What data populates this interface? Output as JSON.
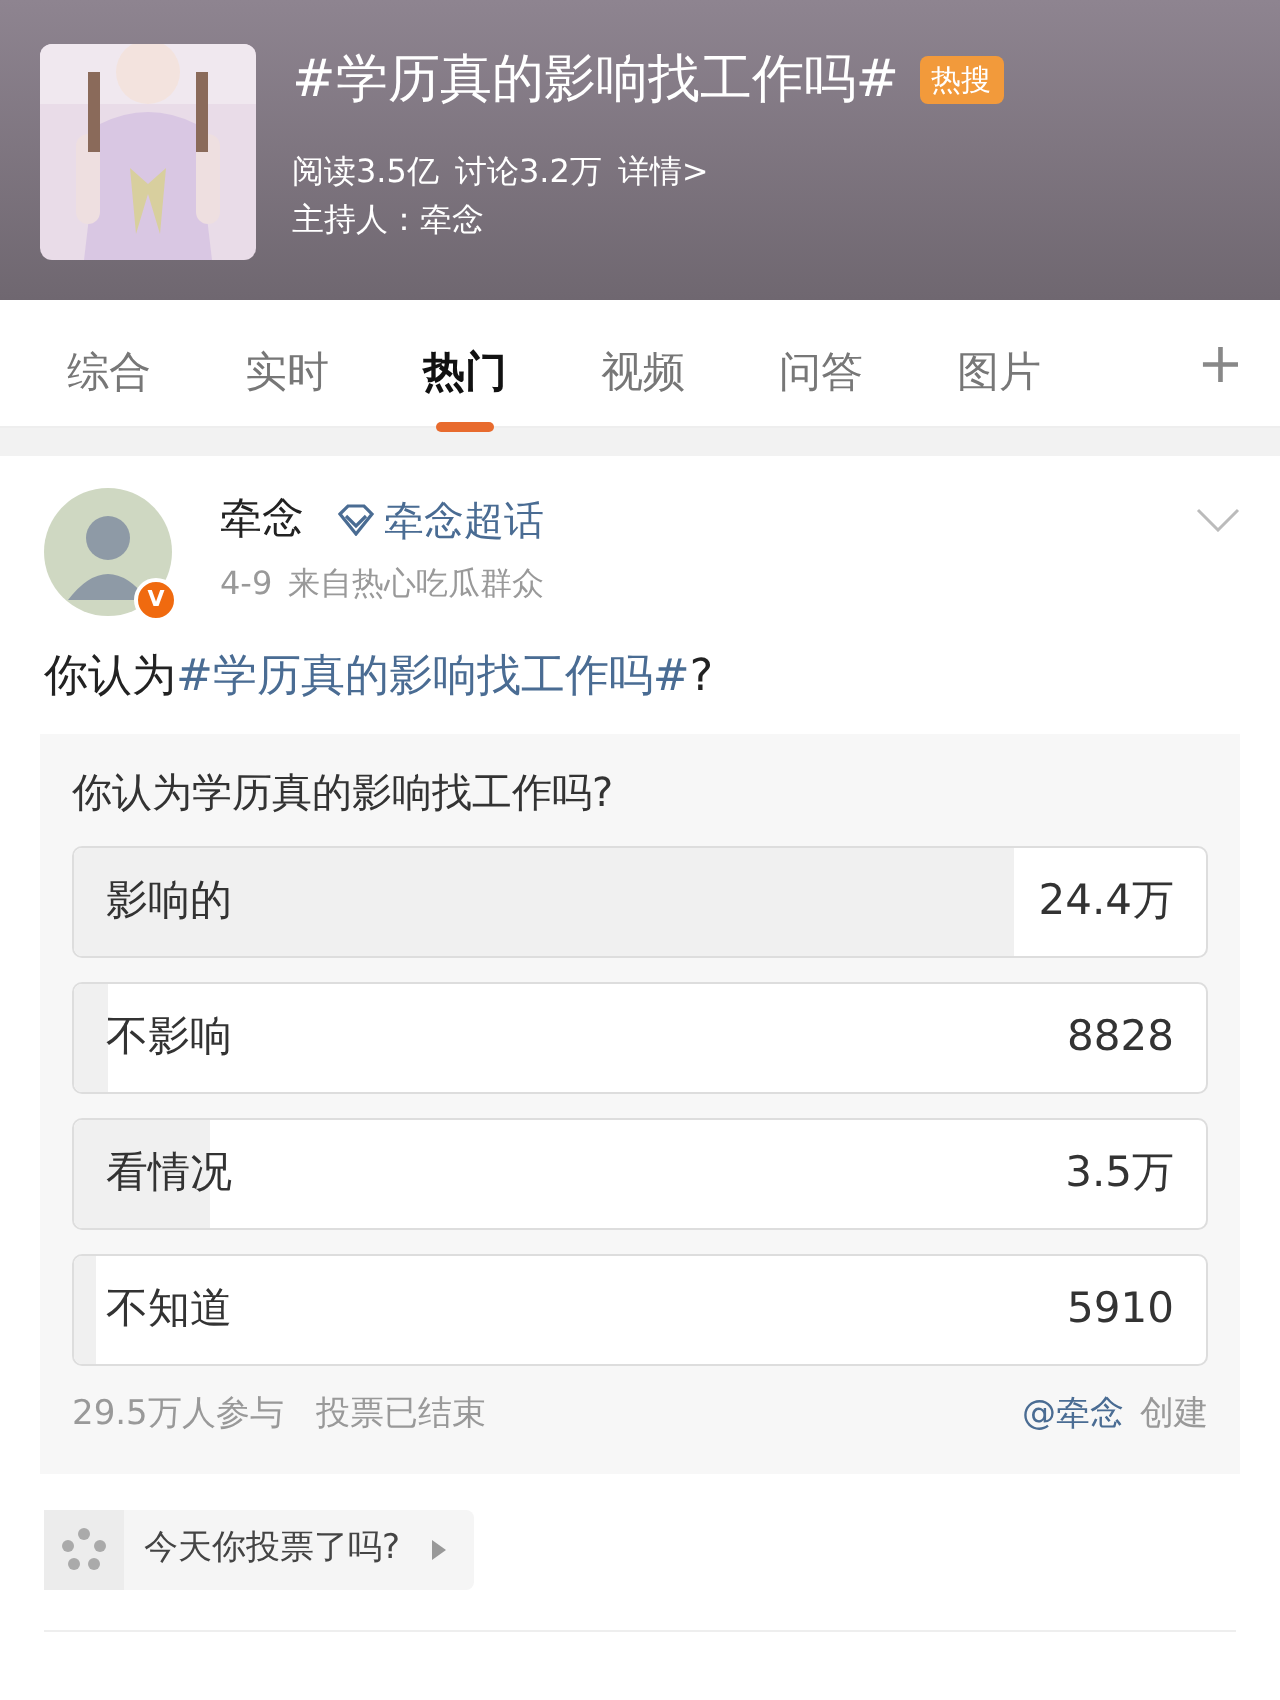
{
  "topic": {
    "title": "#学历真的影响找工作吗#",
    "badge": "热搜",
    "stats": [
      "阅读3.5亿",
      "讨论3.2万",
      "详情>"
    ],
    "host": "主持人：牵念"
  },
  "tabs": [
    {
      "label": "综合",
      "selected": false
    },
    {
      "label": "实时",
      "selected": false
    },
    {
      "label": "热门",
      "selected": true
    },
    {
      "label": "视频",
      "selected": false
    },
    {
      "label": "问答",
      "selected": false
    },
    {
      "label": "图片",
      "selected": false
    }
  ],
  "tab_add": "+",
  "post": {
    "author": "牵念",
    "verified_mark": "V",
    "super_topic": "牵念超话",
    "date": "4-9",
    "source": "来自热心吃瓜群众",
    "text": "你认为",
    "hashtag": "#学历真的影响找工作吗#",
    "text_end": "?"
  },
  "poll": {
    "question": "你认为学历真的影响找工作吗?",
    "options": [
      {
        "label": "影响的",
        "count": "24.4万",
        "level": 0.83
      },
      {
        "label": "不影响",
        "count": "8828",
        "level": 0.03
      },
      {
        "label": "看情况",
        "count": "3.5万",
        "level": 0.12
      },
      {
        "label": "不知道",
        "count": "5910",
        "level": 0.02
      }
    ],
    "participants": "29.5万人参与",
    "status": "投票已结束",
    "creator": "@牵念",
    "creator_suffix": "创建"
  },
  "vote_prompt": "今天你投票了吗?"
}
